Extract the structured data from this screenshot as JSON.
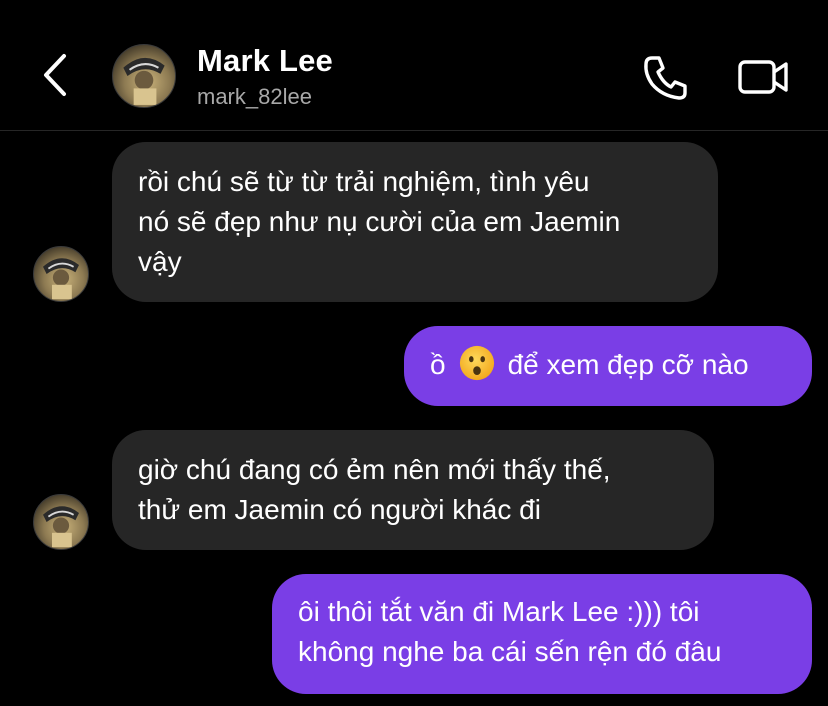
{
  "header": {
    "name": "Mark Lee",
    "handle": "mark_82lee",
    "icons": {
      "back": "chevron-left-icon",
      "call": "phone-icon",
      "video": "video-camera-icon"
    }
  },
  "messages": [
    {
      "direction": "in",
      "lines": [
        "rồi chú sẽ từ từ trải nghiệm, tình yêu",
        "nó sẽ đẹp như nụ cười của em Jaemin",
        "vậy"
      ]
    },
    {
      "direction": "out",
      "before": "ồ",
      "emoji": "frowning-face-emoji",
      "after": "để xem đẹp cỡ nào"
    },
    {
      "direction": "in",
      "lines": [
        "giờ chú đang có ẻm nên mới thấy thế,",
        "thử em Jaemin có người khác đi"
      ]
    },
    {
      "direction": "out",
      "lines": [
        "ôi thôi tắt văn đi Mark Lee :))) tôi",
        "không nghe ba cái sến rện đó đâu"
      ]
    }
  ],
  "colors": {
    "background": "#000000",
    "incoming_bubble": "#262626",
    "outgoing_bubble": "#7a3ee6",
    "handle_text": "#a8a8a8"
  }
}
